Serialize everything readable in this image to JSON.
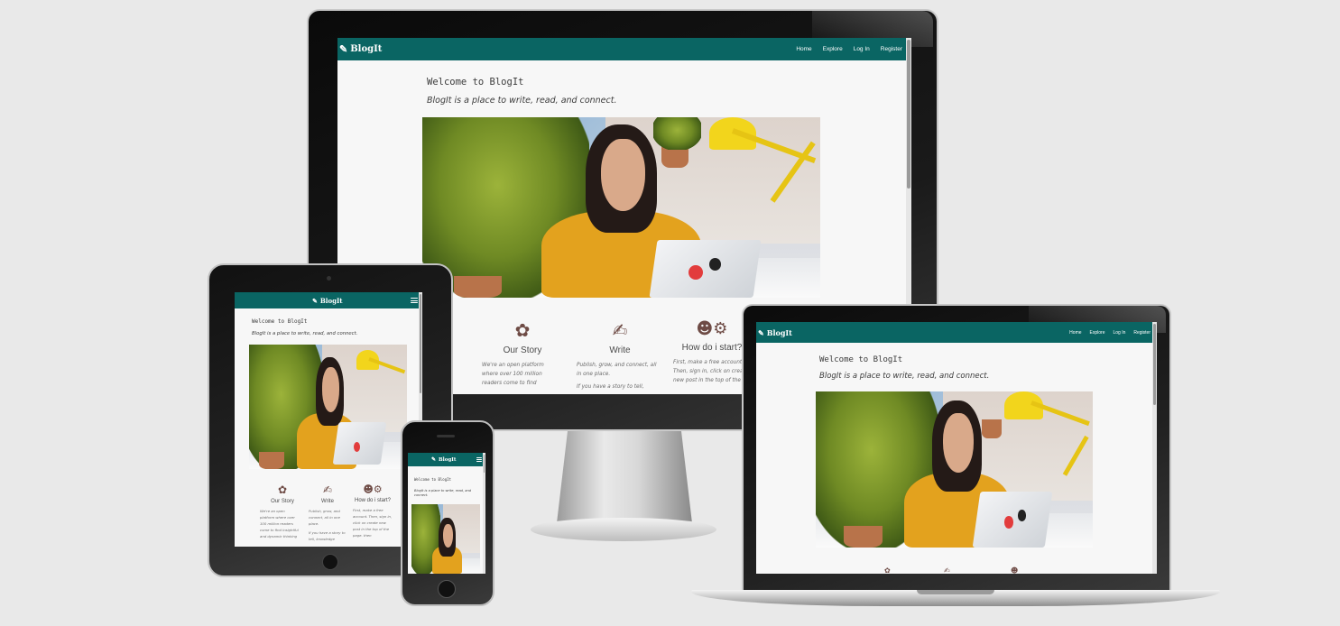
{
  "brand": {
    "name": "BlogIt",
    "logo_icon": "feather-icon",
    "nav_color": "#0a6563"
  },
  "nav": {
    "home": "Home",
    "explore": "Explore",
    "login": "Log In",
    "register": "Register"
  },
  "hero": {
    "welcome": "Welcome to BlogIt",
    "tagline": "BlogIt is a place to write, read, and connect."
  },
  "features": [
    {
      "icon": "gear-flower-icon",
      "title": "Our Story",
      "text_monitor": "We're an open platform where over 100 million readers come to find",
      "text_tablet": "We're an open platform where over 100 million readers come to find insightful and dynamic thinking"
    },
    {
      "icon": "edit-icon",
      "title": "Write",
      "text_monitor_p1": "Publish, grow, and connect, all in one place.",
      "text_monitor_p2": "If you have a story to tell,",
      "text_tablet_p1": "Publish, grow, and connect, all in one place.",
      "text_tablet_p2": "If you have a story to tell, knowledge"
    },
    {
      "icon": "users-cog-icon",
      "title": "How do i start?",
      "text_monitor": "First, make a free account. Then, sign in, click on create new post in the top of the",
      "text_tablet": "First, make a free account. Then, sign in, click on create new post in the top of the page. then"
    }
  ]
}
